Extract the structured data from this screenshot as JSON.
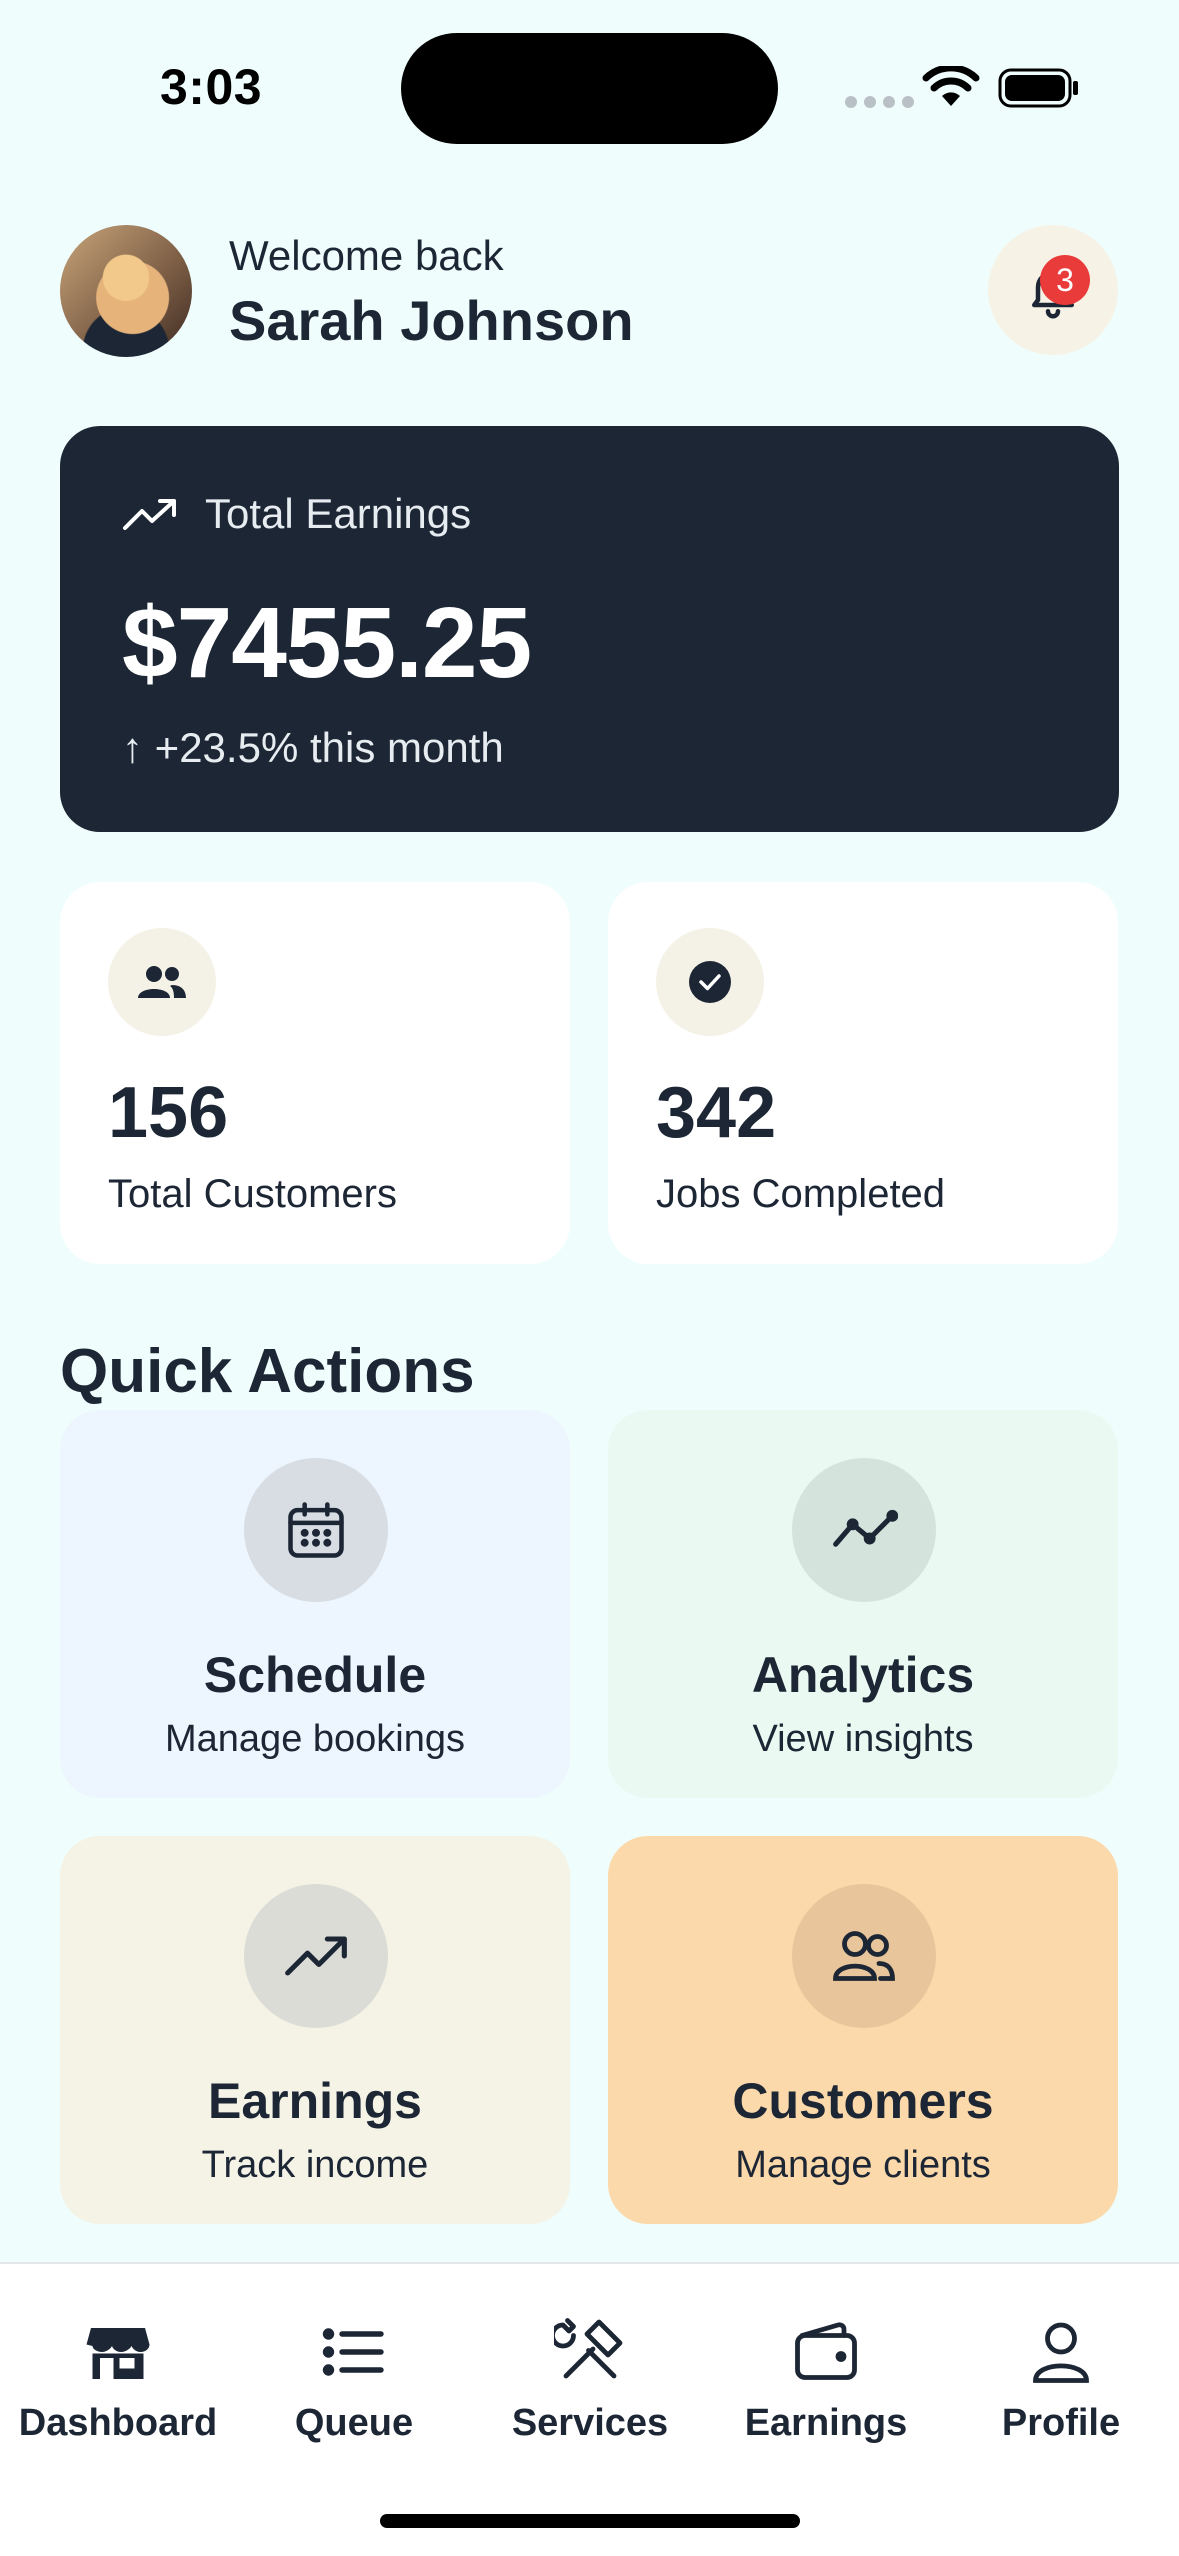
{
  "status_bar": {
    "time": "3:03"
  },
  "header": {
    "welcome": "Welcome back",
    "user_name": "Sarah Johnson",
    "notification_count": "3"
  },
  "earnings": {
    "label": "Total Earnings",
    "amount": "$7455.25",
    "change": "↑ +23.5% this month"
  },
  "stats": [
    {
      "value": "156",
      "label": "Total Customers",
      "icon": "users-icon"
    },
    {
      "value": "342",
      "label": "Jobs Completed",
      "icon": "check-circle-icon"
    }
  ],
  "quick_actions": {
    "title": "Quick Actions",
    "items": [
      {
        "title": "Schedule",
        "subtitle": "Manage bookings",
        "icon": "calendar-icon"
      },
      {
        "title": "Analytics",
        "subtitle": "View insights",
        "icon": "line-chart-icon"
      },
      {
        "title": "Earnings",
        "subtitle": "Track income",
        "icon": "trend-up-icon"
      },
      {
        "title": "Customers",
        "subtitle": "Manage clients",
        "icon": "users-icon"
      }
    ]
  },
  "tab_bar": {
    "tabs": [
      {
        "label": "Dashboard",
        "icon": "store-icon"
      },
      {
        "label": "Queue",
        "icon": "list-icon"
      },
      {
        "label": "Services",
        "icon": "tools-icon"
      },
      {
        "label": "Earnings",
        "icon": "wallet-icon"
      },
      {
        "label": "Profile",
        "icon": "person-icon"
      }
    ]
  },
  "colors": {
    "background": "#effdfc",
    "dark_card": "#1c2634",
    "badge": "#ea3b3b",
    "customers_tile": "#fcd9aa"
  }
}
